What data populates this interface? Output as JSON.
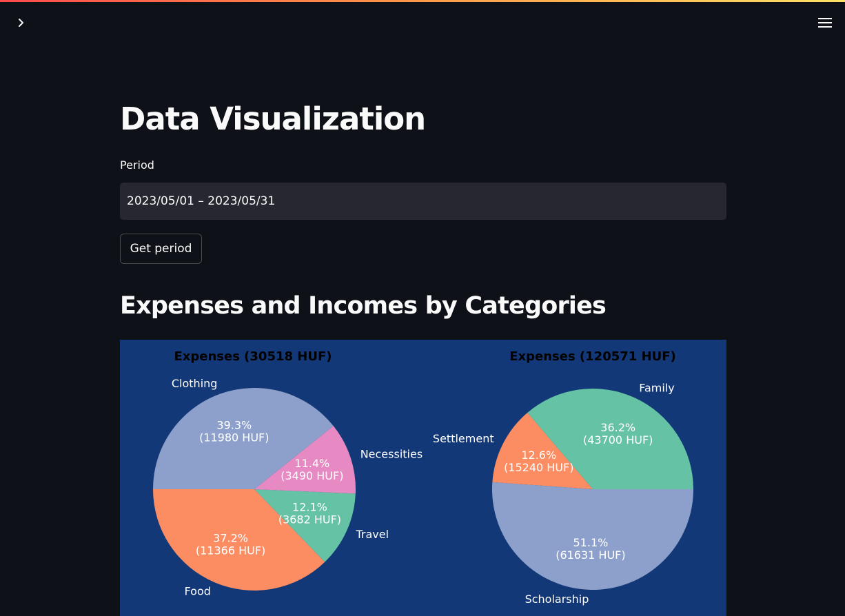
{
  "app": {
    "page_title": "Data Visualization",
    "section_heading": "Expenses and Incomes by Categories"
  },
  "form": {
    "period_label": "Period",
    "period_value": "2023/05/01 – 2023/05/31",
    "get_period_label": "Get period"
  },
  "colors": {
    "background": "#0e1117",
    "chart_background": "#133877",
    "input_background": "#262730"
  },
  "icons": {
    "sidebar_toggle": "chevron-right-icon",
    "menu": "hamburger-menu-icon"
  },
  "chart_data": [
    {
      "type": "pie",
      "title": "Expenses (30518 HUF)",
      "categories": [
        "Food",
        "Travel",
        "Necessities",
        "Clothing"
      ],
      "values": [
        11366,
        3682,
        3490,
        11980
      ],
      "percent_labels": [
        "37.2%",
        "12.1%",
        "11.4%",
        "39.3%"
      ],
      "value_labels": [
        "(11366 HUF)",
        "(3682 HUF)",
        "(3490 HUF)",
        "(11980 HUF)"
      ],
      "colors": [
        "#fc8d62",
        "#66c2a5",
        "#e78ac3",
        "#8da0cb"
      ]
    },
    {
      "type": "pie",
      "title": "Expenses (120571 HUF)",
      "categories": [
        "Family",
        "Settlement",
        "Scholarship"
      ],
      "values": [
        43700,
        15240,
        61631
      ],
      "percent_labels": [
        "36.2%",
        "12.6%",
        "51.1%"
      ],
      "value_labels": [
        "(43700 HUF)",
        "(15240 HUF)",
        "(61631 HUF)"
      ],
      "colors": [
        "#66c2a5",
        "#fc8d62",
        "#8da0cb"
      ]
    }
  ]
}
